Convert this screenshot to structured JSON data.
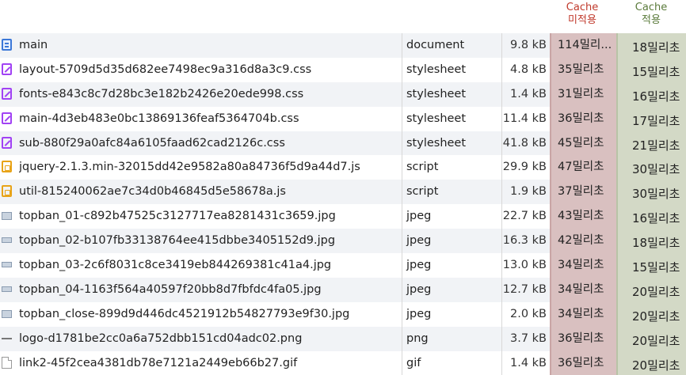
{
  "headers": {
    "uncached_line1": "Cache",
    "uncached_line2": "미적용",
    "cached_line1": "Cache",
    "cached_line2": "적용"
  },
  "rows": [
    {
      "icon": "document-icon",
      "name": "main",
      "type": "document",
      "size": "9.8 kB",
      "time_uncached": "114밀리...",
      "time_cached": "18밀리초"
    },
    {
      "icon": "stylesheet-icon",
      "name": "layout-5709d5d35d682ee7498ec9a316d8a3c9.css",
      "type": "stylesheet",
      "size": "4.8 kB",
      "time_uncached": "35밀리초",
      "time_cached": "15밀리초"
    },
    {
      "icon": "stylesheet-icon",
      "name": "fonts-e843c8c7d28bc3e182b2426e20ede998.css",
      "type": "stylesheet",
      "size": "1.4 kB",
      "time_uncached": "31밀리초",
      "time_cached": "16밀리초"
    },
    {
      "icon": "stylesheet-icon",
      "name": "main-4d3eb483e0bc13869136feaf5364704b.css",
      "type": "stylesheet",
      "size": "11.4 kB",
      "time_uncached": "36밀리초",
      "time_cached": "17밀리초"
    },
    {
      "icon": "stylesheet-icon",
      "name": "sub-880f29a0afc84a6105faad62cad2126c.css",
      "type": "stylesheet",
      "size": "41.8 kB",
      "time_uncached": "45밀리초",
      "time_cached": "21밀리초"
    },
    {
      "icon": "script-icon",
      "name": "jquery-2.1.3.min-32015dd42e9582a80a84736f5d9a44d7.js",
      "type": "script",
      "size": "29.9 kB",
      "time_uncached": "47밀리초",
      "time_cached": "30밀리초"
    },
    {
      "icon": "script-icon",
      "name": "util-815240062ae7c34d0b46845d5e58678a.js",
      "type": "script",
      "size": "1.9 kB",
      "time_uncached": "37밀리초",
      "time_cached": "30밀리초"
    },
    {
      "icon": "image-icon",
      "name": "topban_01-c892b47525c3127717ea8281431c3659.jpg",
      "type": "jpeg",
      "size": "22.7 kB",
      "time_uncached": "43밀리초",
      "time_cached": "16밀리초"
    },
    {
      "icon": "image-icon",
      "name": "topban_02-b107fb33138764ee415dbbe3405152d9.jpg",
      "type": "jpeg",
      "size": "16.3 kB",
      "time_uncached": "42밀리초",
      "time_cached": "18밀리초"
    },
    {
      "icon": "image-icon",
      "name": "topban_03-2c6f8031c8ce3419eb844269381c41a4.jpg",
      "type": "jpeg",
      "size": "13.0 kB",
      "time_uncached": "34밀리초",
      "time_cached": "15밀리초"
    },
    {
      "icon": "image-icon",
      "name": "topban_04-1163f564a40597f20bb8d7fbfdc4fa05.jpg",
      "type": "jpeg",
      "size": "12.7 kB",
      "time_uncached": "34밀리초",
      "time_cached": "20밀리초"
    },
    {
      "icon": "image-icon",
      "name": "topban_close-899d9d446dc4521912b54827793e9f30.jpg",
      "type": "jpeg",
      "size": "2.0 kB",
      "time_uncached": "34밀리초",
      "time_cached": "20밀리초"
    },
    {
      "icon": "png-image-icon",
      "name": "logo-d1781be2cc0a6a752dbb151cd04adc02.png",
      "type": "png",
      "size": "3.7 kB",
      "time_uncached": "36밀리초",
      "time_cached": "20밀리초"
    },
    {
      "icon": "gif-image-icon",
      "name": "link2-45f2cea4381db78e7121a2449eb66b27.gif",
      "type": "gif",
      "size": "1.4 kB",
      "time_uncached": "36밀리초",
      "time_cached": "20밀리초"
    }
  ]
}
